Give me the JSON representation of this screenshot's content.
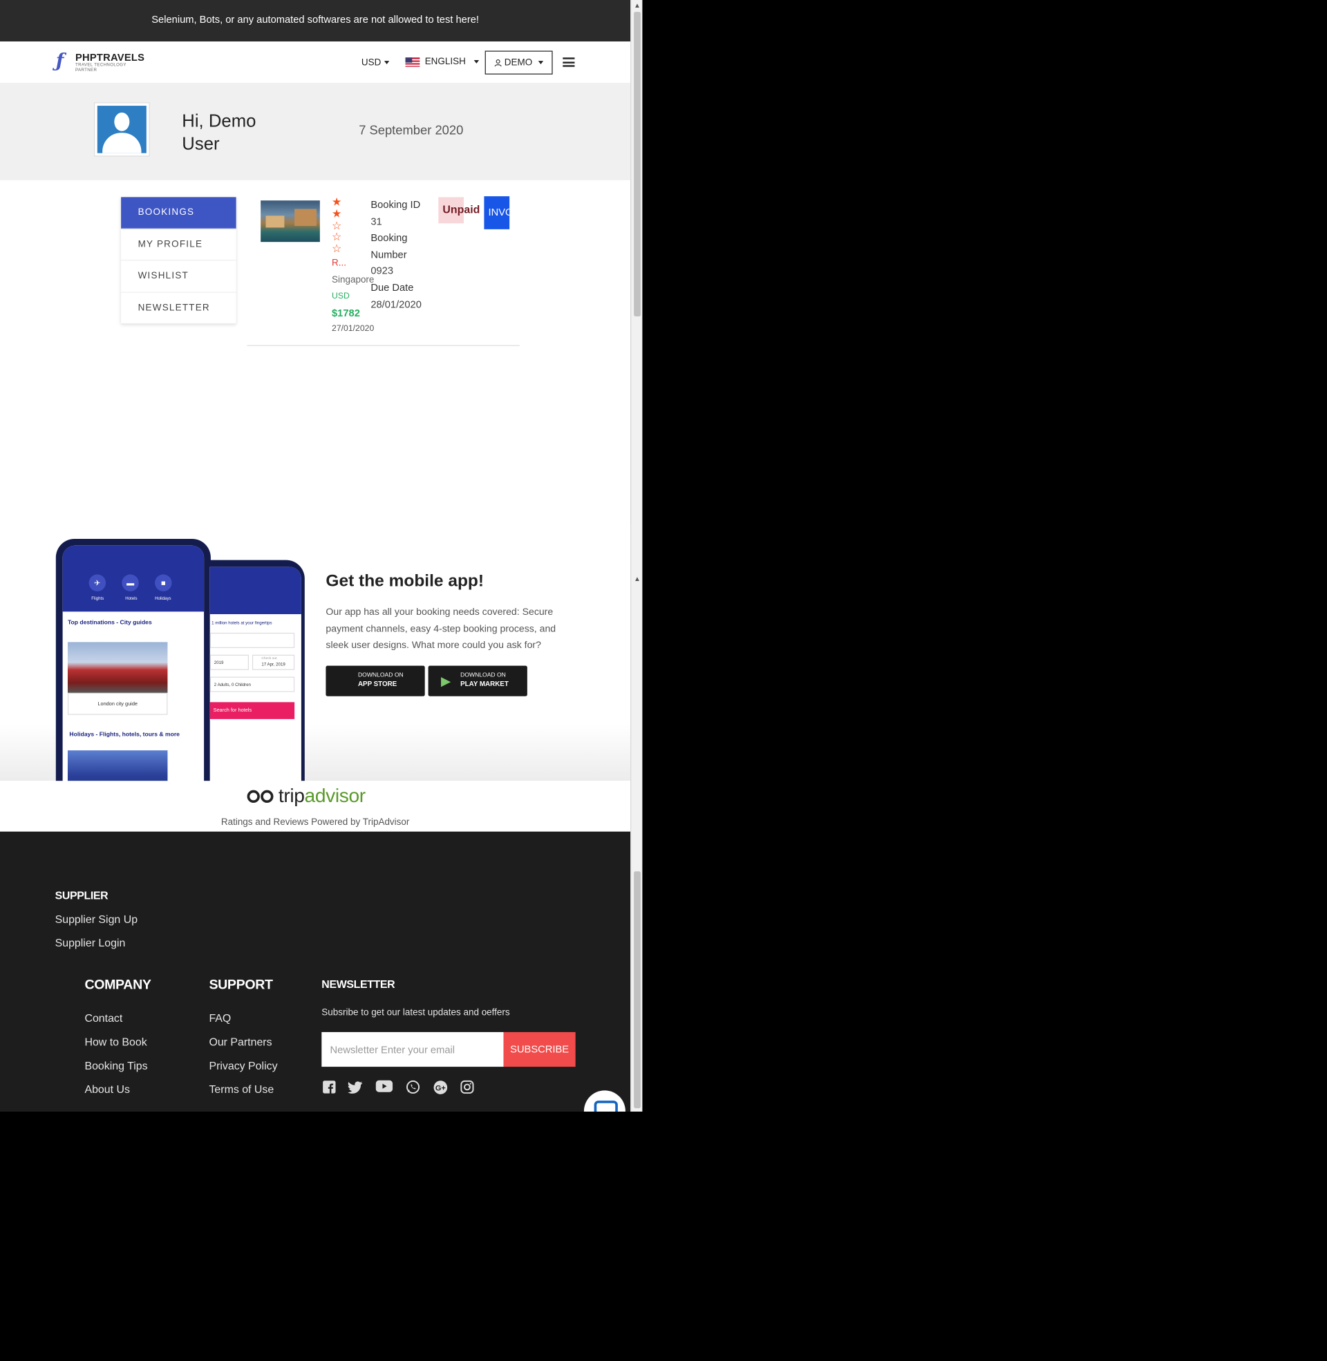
{
  "topbar": {
    "notice": "Selenium, Bots, or any automated softwares are not allowed to test here!"
  },
  "navbar": {
    "logo_name": "PHPTRAVELS",
    "logo_tagline": "TRAVEL TECHNOLOGY PARTNER",
    "currency": "USD",
    "language": "ENGLISH",
    "account": "DEMO"
  },
  "hero": {
    "greeting": "Hi, Demo User",
    "date": "7 September 2020"
  },
  "sidebar": {
    "items": [
      {
        "label": "BOOKINGS",
        "active": true
      },
      {
        "label": "MY PROFILE"
      },
      {
        "label": "WISHLIST"
      },
      {
        "label": "NEWSLETTER"
      }
    ]
  },
  "booking": {
    "rating": 2,
    "name": "R...",
    "city": "Singapore",
    "currency": "USD",
    "price": "$1782",
    "date": "27/01/2020",
    "booking_id_label": "Booking ID",
    "booking_id": "31",
    "booking_number_label": "Booking Number",
    "booking_number": "0923",
    "due_date_label": "Due Date",
    "due_date": "28/01/2020",
    "status": "Unpaid",
    "invoice_label": "INVOICE"
  },
  "app": {
    "title": "Get the mobile app!",
    "description": "Our app has all your booking needs covered: Secure payment channels, easy 4-step booking process, and sleek user designs. What more could you ask for?",
    "appstore_line1": "DOWNLOAD ON",
    "appstore_line2": "APP STORE",
    "playstore_line1": "DOWNLOAD ON",
    "playstore_line2": "PLAY MARKET",
    "phone1": {
      "tabs": [
        "Flights",
        "Hotels",
        "Holidays"
      ],
      "section1": "Top destinations - City guides",
      "card": "London city guide",
      "section2": "Holidays - Flights, hotels, tours & more"
    },
    "phone2": {
      "tagline": "1 million hotels at your fingertips",
      "date1": "2019",
      "checkout_label": "Check out",
      "date2": "17 Apr, 2019",
      "guests": "2 Adults, 0 Children",
      "search": "Search for hotels"
    }
  },
  "tripadvisor": {
    "word_a": "trip",
    "word_b": "advisor",
    "caption": "Ratings and Reviews Powered by TripAdvisor"
  },
  "footer": {
    "supplier_heading": "SUPPLIER",
    "supplier_links": [
      "Supplier Sign Up",
      "Supplier Login"
    ],
    "company_heading": "COMPANY",
    "company_links": [
      "Contact",
      "How to Book",
      "Booking Tips",
      "About Us"
    ],
    "support_heading": "SUPPORT",
    "support_links": [
      "FAQ",
      "Our Partners",
      "Privacy Policy",
      "Terms of Use"
    ],
    "newsletter_heading": "NEWSLETTER",
    "newsletter_text": "Subsribe to get our latest updates and oeffers",
    "newsletter_placeholder": "Newsletter Enter your email",
    "subscribe_label": "SUBSCRIBE",
    "social_icons": [
      "facebook-icon",
      "twitter-icon",
      "youtube-icon",
      "whatsapp-icon",
      "google-plus-icon",
      "instagram-icon"
    ]
  },
  "colors": {
    "accent": "#3e55c4",
    "danger": "#f24b4b",
    "success": "#27ae60",
    "invoice": "#1856e8"
  }
}
